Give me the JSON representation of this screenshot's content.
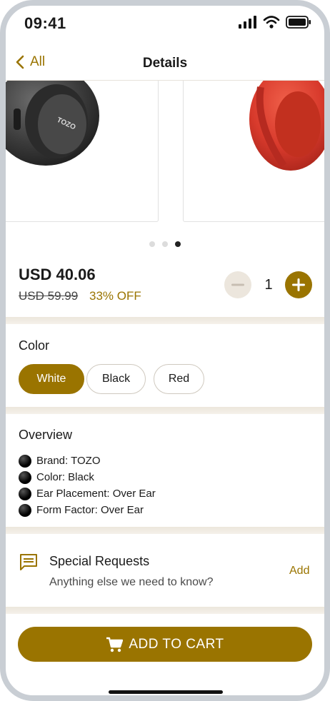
{
  "status_bar": {
    "time": "09:41"
  },
  "nav": {
    "back_label": "All",
    "title": "Details"
  },
  "carousel": {
    "slide_count": 3,
    "active_index": 2,
    "left_slide_brand": "TOZO"
  },
  "pricing": {
    "price": "USD 40.06",
    "original_price": "USD 59.99",
    "discount": "33% OFF",
    "quantity": "1"
  },
  "color": {
    "title": "Color",
    "options": [
      "White",
      "Black",
      "Red"
    ],
    "selected": "White"
  },
  "overview": {
    "title": "Overview",
    "items": [
      "Brand: TOZO",
      "Color: Black",
      "Ear Placement: Over Ear",
      "Form Factor: Over Ear"
    ]
  },
  "special_requests": {
    "title": "Special Requests",
    "subtitle": "Anything else we need to know?",
    "action": "Add"
  },
  "cart": {
    "label": "ADD TO CART"
  },
  "colors": {
    "accent": "#9a7400",
    "minus_bg": "#ece6dd",
    "divider": "#ece6dc"
  },
  "icons": [
    "back-chevron-icon",
    "signal-icon",
    "wifi-icon",
    "battery-icon",
    "minus-icon",
    "plus-icon",
    "message-icon",
    "cart-icon"
  ]
}
